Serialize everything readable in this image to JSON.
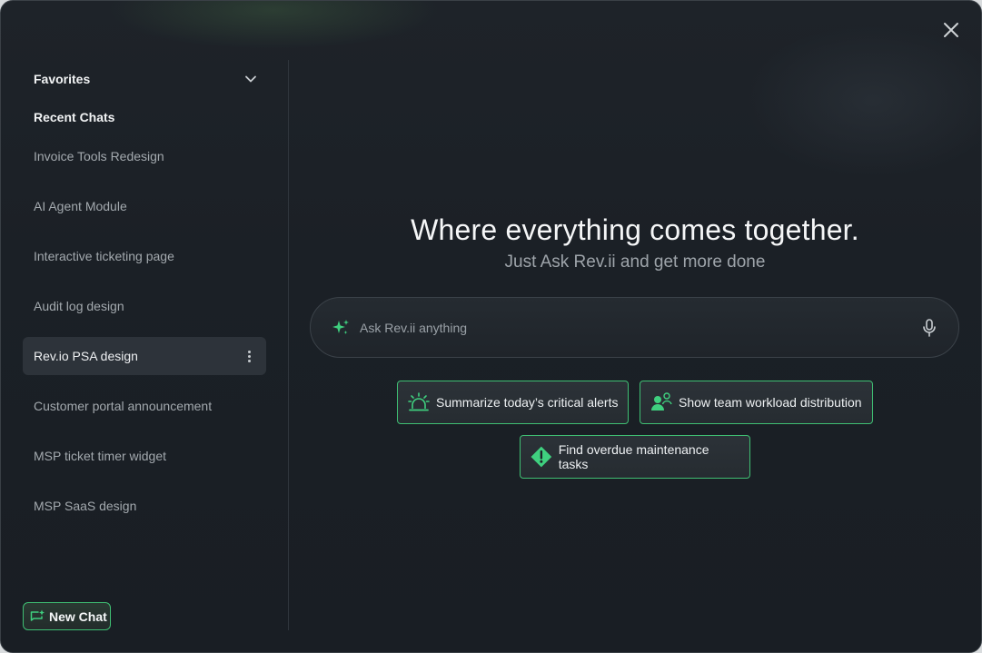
{
  "window": {
    "close_label": "close"
  },
  "sidebar": {
    "favorites_label": "Favorites",
    "recent_label": "Recent Chats",
    "items": [
      {
        "label": "Invoice Tools Redesign"
      },
      {
        "label": "AI Agent Module"
      },
      {
        "label": "Interactive ticketing page"
      },
      {
        "label": "Audit log design"
      },
      {
        "label": "Rev.io PSA design",
        "active": true
      },
      {
        "label": "Customer portal announcement"
      },
      {
        "label": "MSP ticket timer widget"
      },
      {
        "label": "MSP SaaS design"
      }
    ],
    "new_chat_label": "New Chat"
  },
  "main": {
    "headline": "Where everything comes together.",
    "subhead": "Just Ask Rev.ii and get more done",
    "search": {
      "placeholder": "Ask Rev.ii anything",
      "value": ""
    },
    "suggestions": [
      {
        "label": "Summarize today’s critical alerts",
        "icon": "alarm-icon"
      },
      {
        "label": "Show team workload distribution",
        "icon": "team-icon"
      },
      {
        "label": "Find overdue maintenance tasks",
        "icon": "warning-icon"
      }
    ]
  },
  "colors": {
    "accent": "#3fbf73",
    "background": "#1b2026",
    "active_item": "#2d333a"
  }
}
